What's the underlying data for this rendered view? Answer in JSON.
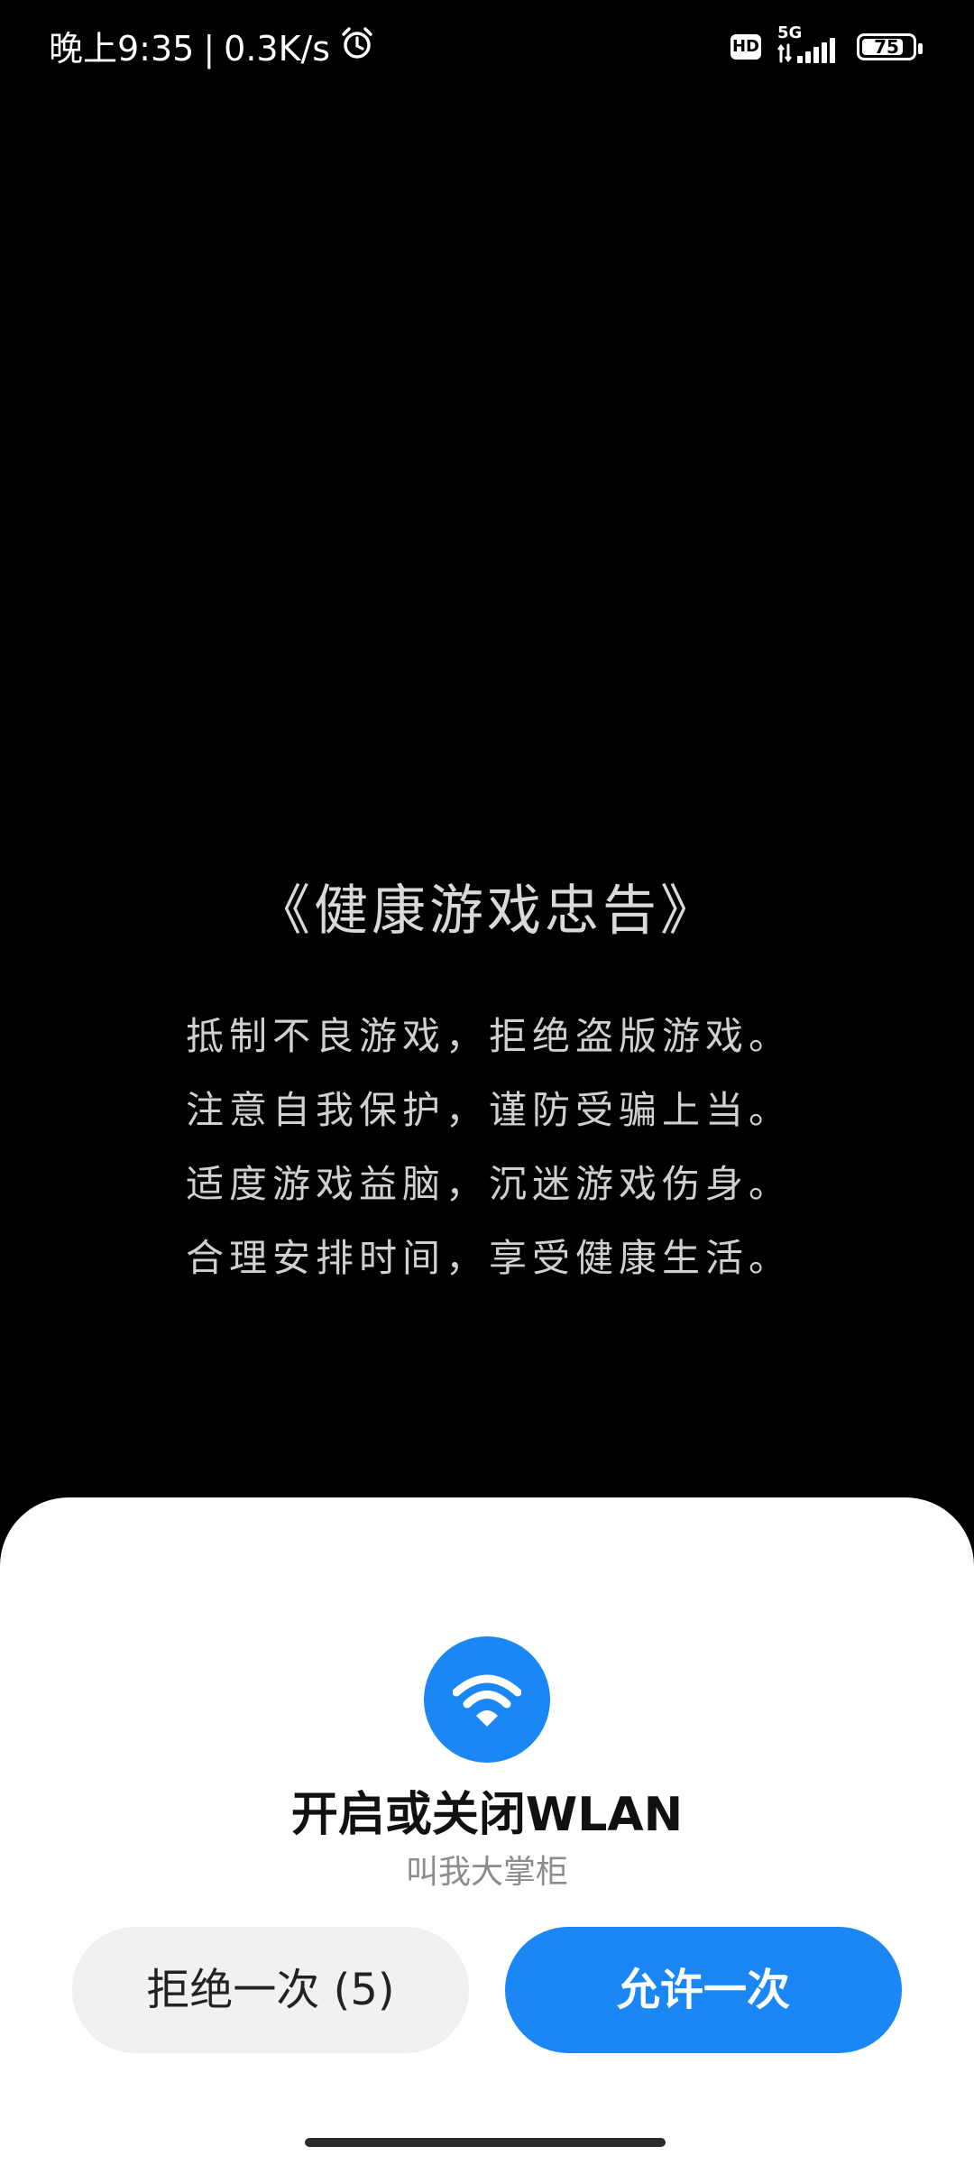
{
  "status_bar": {
    "time": "晚上9:35",
    "separator": "|",
    "net_speed": "0.3K/s",
    "alarm_icon": "alarm-clock-icon",
    "hd_label": "HD",
    "network_gen": "5G",
    "battery_level": "75"
  },
  "advisory": {
    "title": "《健康游戏忠告》",
    "lines": [
      "抵制不良游戏，拒绝盗版游戏。",
      "注意自我保护，谨防受骗上当。",
      "适度游戏益脑，沉迷游戏伤身。",
      "合理安排时间，享受健康生活。"
    ]
  },
  "permission_dialog": {
    "icon": "wifi-icon",
    "title": "开启或关闭WLAN",
    "app_name": "叫我大掌柜",
    "deny_label": "拒绝一次 (5)",
    "allow_label": "允许一次"
  },
  "colors": {
    "accent": "#1a87f4",
    "background": "#000000",
    "sheet": "#ffffff",
    "deny_button": "#f1f1f1"
  }
}
